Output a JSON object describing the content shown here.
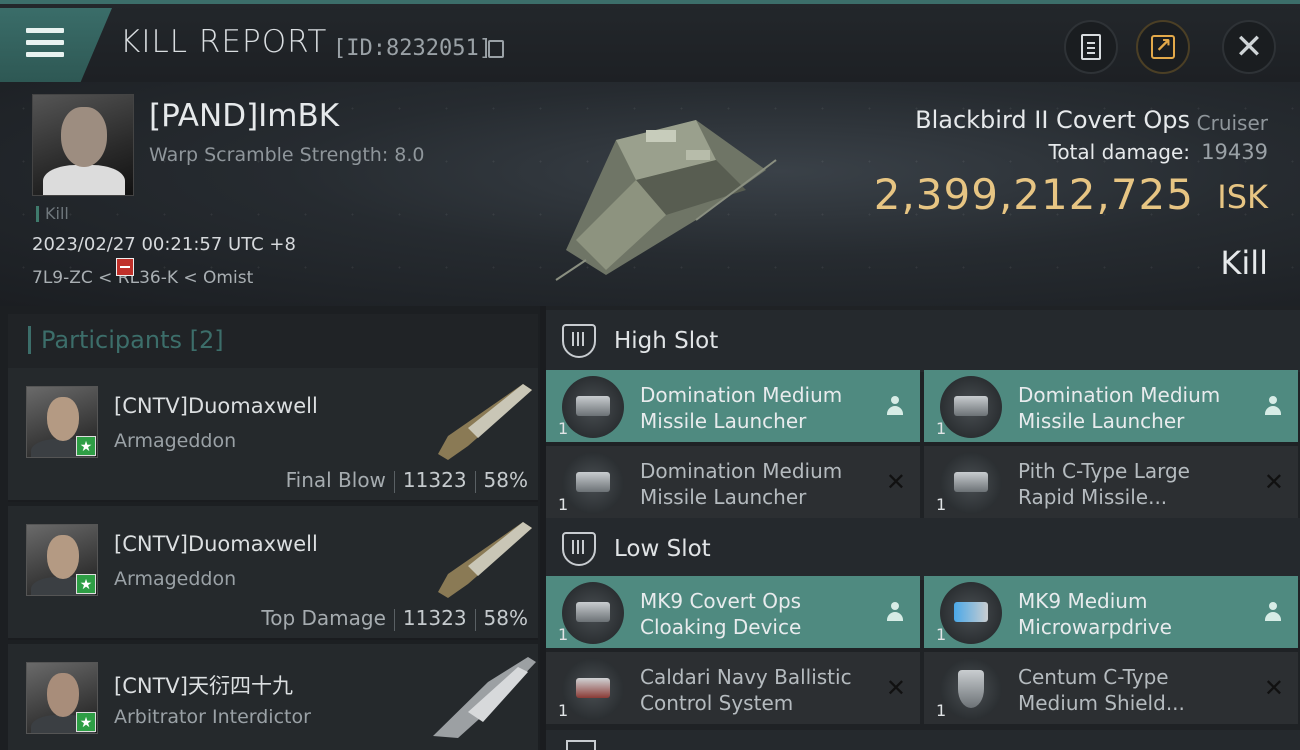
{
  "header": {
    "title": "KILL REPORT",
    "kill_id": "[ID:8232051]",
    "buttons": [
      "clipboard-icon",
      "share-icon",
      "close-icon"
    ]
  },
  "victim": {
    "name": "[PAND]ImBK",
    "warp_scramble": "Warp Scramble Strength: 8.0",
    "kill_tag": "Kill",
    "timestamp": "2023/02/27 00:21:57 UTC +8",
    "location": "7L9-ZC < RL36-K < Omist",
    "ship_name": "Blackbird II Covert Ops",
    "ship_class": "Cruiser",
    "total_damage_label": "Total damage:",
    "total_damage": "19439",
    "isk_value": "2,399,212,725",
    "isk_unit": "ISK",
    "kill_type": "Kill"
  },
  "participants": {
    "label": "Participants [2]",
    "list": [
      {
        "name": "[CNTV]Duomaxwell",
        "ship": "Armageddon",
        "role": "Final Blow",
        "damage": "11323",
        "percent": "58%"
      },
      {
        "name": "[CNTV]Duomaxwell",
        "ship": "Armageddon",
        "role": "Top Damage",
        "damage": "11323",
        "percent": "58%"
      },
      {
        "name": "[CNTV]天衍四十九",
        "ship": "Arbitrator Interdictor"
      }
    ]
  },
  "fitting": {
    "high_slot": {
      "title": "High Slot",
      "items": [
        {
          "name": "Domination Medium Missile Launcher",
          "qty": "1",
          "status": "dropped"
        },
        {
          "name": "Domination Medium Missile Launcher",
          "qty": "1",
          "status": "dropped"
        },
        {
          "name": "Domination Medium Missile Launcher",
          "qty": "1",
          "status": "destroyed"
        },
        {
          "name": "Pith C-Type Large Rapid Missile...",
          "qty": "1",
          "status": "destroyed"
        }
      ]
    },
    "low_slot": {
      "title": "Low Slot",
      "items": [
        {
          "name": "MK9 Covert Ops Cloaking Device",
          "qty": "1",
          "status": "dropped"
        },
        {
          "name": "MK9 Medium Microwarpdrive",
          "qty": "1",
          "status": "dropped"
        },
        {
          "name": "Caldari Navy Ballistic Control System",
          "qty": "1",
          "status": "destroyed"
        },
        {
          "name": "Centum C-Type Medium Shield...",
          "qty": "1",
          "status": "destroyed"
        }
      ]
    }
  },
  "colors": {
    "accent": "#3c6e6a",
    "dropped": "#4f8a80",
    "isk": "#e7c583",
    "badge_green": "#2e9e45",
    "badge_red": "#c0302a"
  },
  "icons": {
    "destroyed": "✕"
  }
}
